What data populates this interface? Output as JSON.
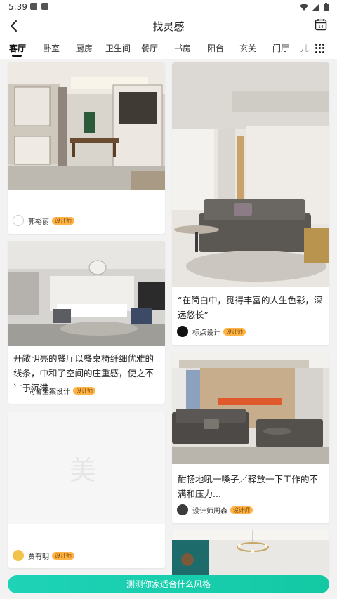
{
  "status_bar": {
    "time": "5:39"
  },
  "header": {
    "title": "找灵感"
  },
  "tabs": [
    "客厅",
    "卧室",
    "厨房",
    "卫生间",
    "餐厅",
    "书房",
    "阳台",
    "玄关",
    "门厅",
    "儿"
  ],
  "active_tab": "客厅",
  "cards": {
    "c1": {
      "author": "郭裕丽",
      "badge": "设计师"
    },
    "c2": {
      "description": "“在简白中，觅得丰富的人生色彩，深远悠长”",
      "author": "标点设计",
      "badge": "设计师"
    },
    "c3": {
      "description": "开敞明亮的餐厅以餐桌椅纤细优雅的线条，中和了空间的庄重感，使之不过于沉滞，...",
      "author": "尚舍全案设计",
      "badge": "设计师"
    },
    "c4": {
      "description": "酣畅地吼一嗓子／释放一下工作的不满和压力...",
      "author": "设计师周森",
      "badge": "设计师"
    },
    "c5": {
      "placeholder_glyph": "美",
      "author": "贾有明",
      "badge": "设计师"
    }
  },
  "bottom_button": {
    "label": "测测你家适合什么风格"
  }
}
